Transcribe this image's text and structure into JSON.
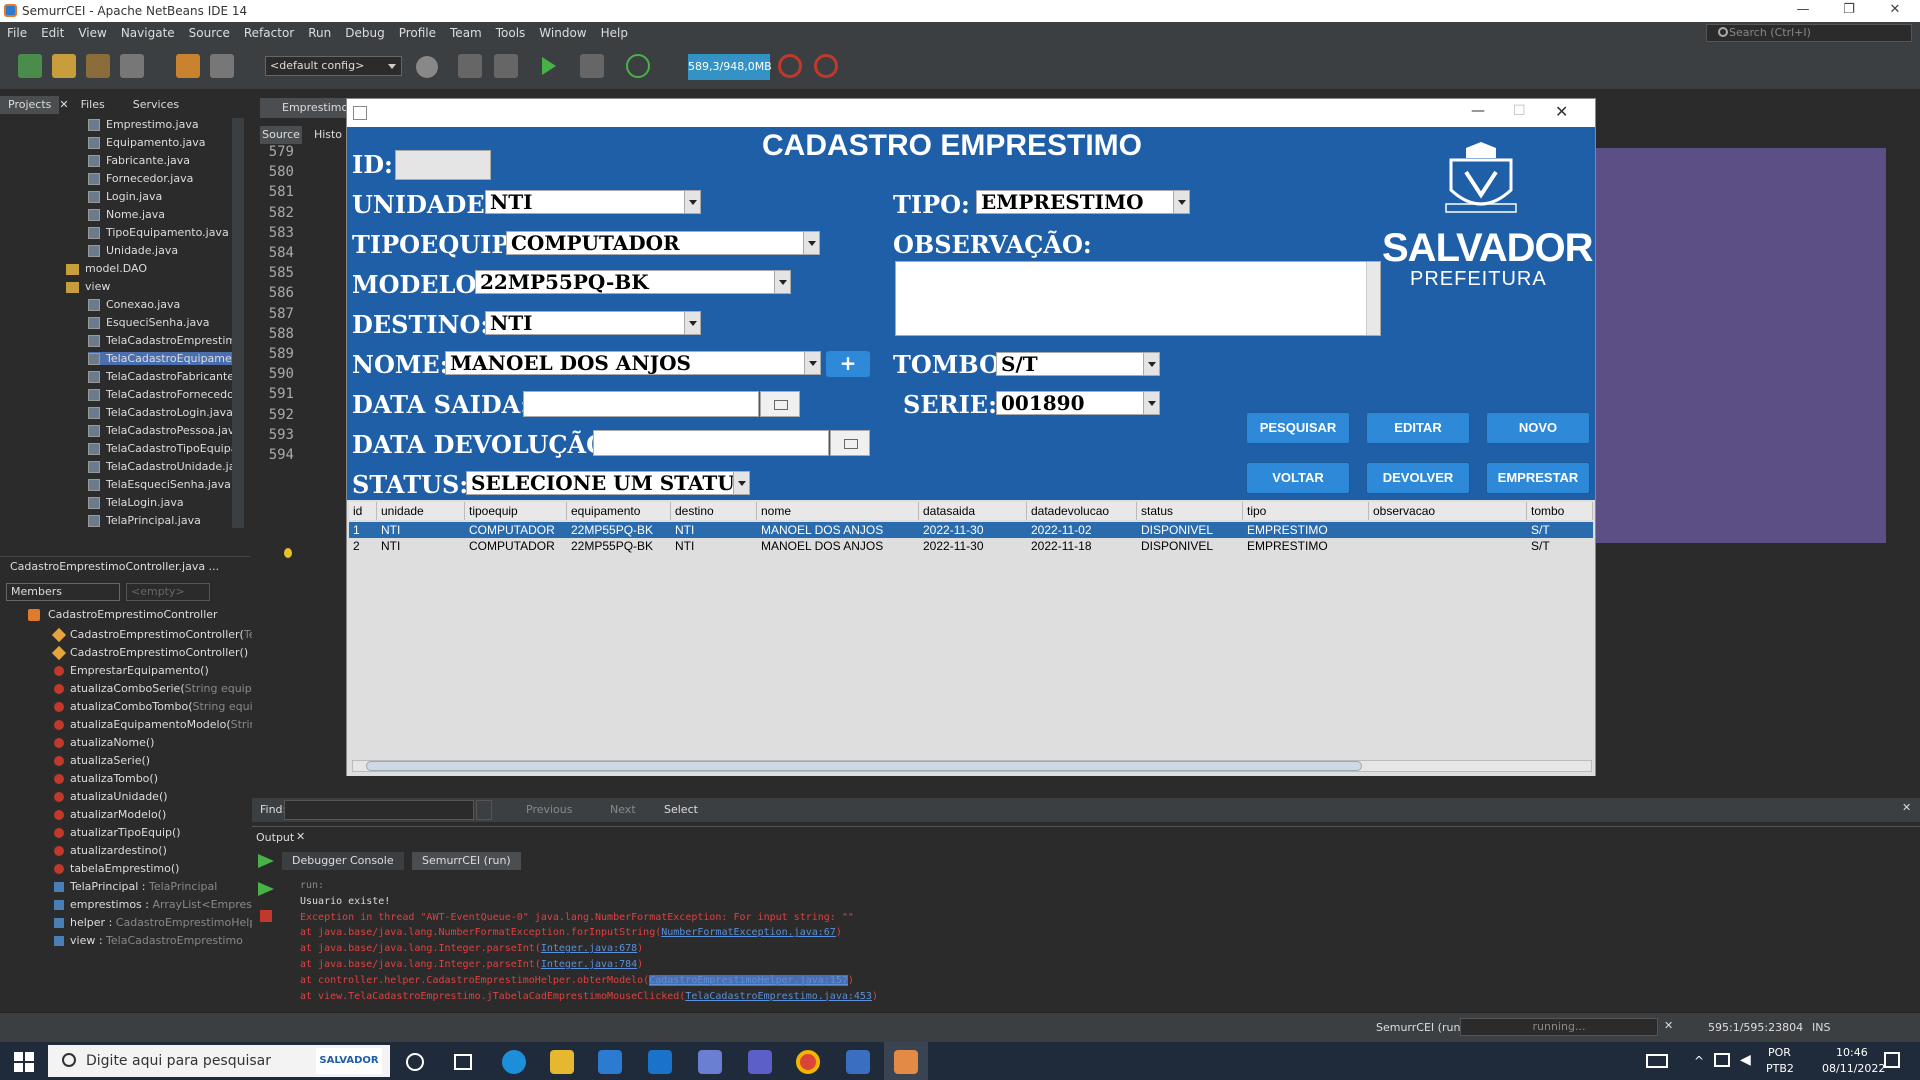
{
  "window": {
    "title": "SemurrCEI - Apache NetBeans IDE 14",
    "search_placeholder": "Search (Ctrl+I)"
  },
  "menu": [
    "File",
    "Edit",
    "View",
    "Navigate",
    "Source",
    "Refactor",
    "Run",
    "Debug",
    "Profile",
    "Team",
    "Tools",
    "Window",
    "Help"
  ],
  "toolbar": {
    "config": "<default config>",
    "memory": "589,3/948,0MB"
  },
  "projects_panel": {
    "tabs": [
      "Projects",
      "Files",
      "Services"
    ],
    "files": [
      "Emprestimo.java",
      "Equipamento.java",
      "Fabricante.java",
      "Fornecedor.java",
      "Login.java",
      "Nome.java",
      "TipoEquipamento.java",
      "Unidade.java"
    ],
    "package_dao": "model.DAO",
    "package_view": "view",
    "view_files": [
      "Conexao.java",
      "EsqueciSenha.java",
      "TelaCadastroEmprestimo",
      "TelaCadastroEquipament",
      "TelaCadastroFabricante.",
      "TelaCadastroFornecedor",
      "TelaCadastroLogin.java",
      "TelaCadastroPessoa.java",
      "TelaCadastroTipoEquipar",
      "TelaCadastroUnidade.jav",
      "TelaEsqueciSenha.java",
      "TelaLogin.java",
      "TelaPrincipal.java"
    ]
  },
  "navigator": {
    "title": "CadastroEmprestimoController.java ...",
    "filter": "Members",
    "filter2": "<empty>",
    "root": "CadastroEmprestimoController",
    "members": [
      {
        "name": "CadastroEmprestimoController(",
        "extra": "TelaC",
        "kind": "ctor"
      },
      {
        "name": "CadastroEmprestimoController()",
        "extra": "",
        "kind": "ctor"
      },
      {
        "name": "EmprestarEquipamento()",
        "extra": "",
        "kind": "method"
      },
      {
        "name": "atualizaComboSerie(",
        "extra": "String equip)",
        "kind": "method"
      },
      {
        "name": "atualizaComboTombo(",
        "extra": "String equip)",
        "kind": "method"
      },
      {
        "name": "atualizaEquipamentoModelo(",
        "extra": "String tip",
        "kind": "method"
      },
      {
        "name": "atualizaNome()",
        "extra": "",
        "kind": "method"
      },
      {
        "name": "atualizaSerie()",
        "extra": "",
        "kind": "method"
      },
      {
        "name": "atualizaTombo()",
        "extra": "",
        "kind": "method"
      },
      {
        "name": "atualizaUnidade()",
        "extra": "",
        "kind": "method"
      },
      {
        "name": "atualizarModelo()",
        "extra": "",
        "kind": "method"
      },
      {
        "name": "atualizarTipoEquip()",
        "extra": "",
        "kind": "method"
      },
      {
        "name": "atualizardestino()",
        "extra": "",
        "kind": "method"
      },
      {
        "name": "tabelaEmprestimo()",
        "extra": "",
        "kind": "method"
      },
      {
        "name": "TelaPrincipal : ",
        "extra": "TelaPrincipal",
        "kind": "field"
      },
      {
        "name": "emprestimos : ",
        "extra": "ArrayList<Emprestimo",
        "kind": "field"
      },
      {
        "name": "helper : ",
        "extra": "CadastroEmprestimoHelper",
        "kind": "field"
      },
      {
        "name": "view : ",
        "extra": "TelaCadastroEmprestimo",
        "kind": "field"
      }
    ]
  },
  "editor": {
    "tab": "Emprestimo.j",
    "subtabs": [
      "Source",
      "Histo"
    ],
    "line_numbers": [
      "579",
      "580",
      "581",
      "582",
      "583",
      "584",
      "585",
      "586",
      "587",
      "588",
      "589",
      "590",
      "591",
      "592",
      "593",
      "594"
    ]
  },
  "dialog": {
    "title": "CADASTRO EMPRESTIMO",
    "labels": {
      "id": "ID:",
      "unidade": "UNIDADE:",
      "tipoequip": "TIPOEQUIP:",
      "modelo": "MODELO:",
      "destino": "DESTINO:",
      "nome": "NOME:",
      "data_saida": "DATA SAIDA:",
      "data_devolucao": "DATA DEVOLUÇÃO:",
      "status": "STATUS:",
      "tipo": "TIPO:",
      "observacao": "OBSERVAÇÃO:",
      "tombo": "TOMBO:",
      "serie": "SERIE:"
    },
    "values": {
      "unidade": "NTI",
      "tipoequip": "COMPUTADOR",
      "modelo": "22MP55PQ-BK",
      "destino": "NTI",
      "nome": "MANOEL DOS ANJOS",
      "status": "SELECIONE UM STATUS",
      "tipo": "EMPRESTIMO",
      "tombo": "S/T",
      "serie": "001890"
    },
    "add_button": "+",
    "logo": {
      "name": "SALVADOR",
      "sub": "PREFEITURA"
    },
    "buttons": {
      "pesquisar": "PESQUISAR",
      "editar": "EDITAR",
      "novo": "NOVO",
      "voltar": "VOLTAR",
      "devolver": "DEVOLVER",
      "emprestar": "EMPRESTAR"
    },
    "table": {
      "columns": [
        "id",
        "unidade",
        "tipoequip",
        "equipamento",
        "destino",
        "nome",
        "datasaida",
        "datadevolucao",
        "status",
        "tipo",
        "observacao",
        "tombo"
      ],
      "rows": [
        [
          "1",
          "NTI",
          "COMPUTADOR",
          "22MP55PQ-BK",
          "NTI",
          "MANOEL DOS ANJOS",
          "2022-11-30",
          "2022-11-02",
          "DISPONIVEL",
          "EMPRESTIMO",
          "",
          "S/T"
        ],
        [
          "2",
          "NTI",
          "COMPUTADOR",
          "22MP55PQ-BK",
          "NTI",
          "MANOEL DOS ANJOS",
          "2022-11-30",
          "2022-11-18",
          "DISPONIVEL",
          "EMPRESTIMO",
          "",
          "S/T"
        ]
      ]
    }
  },
  "findbar": {
    "label": "Find:",
    "previous": "Previous",
    "next": "Next",
    "select": "Select"
  },
  "output": {
    "title": "Output",
    "tabs": [
      "Debugger Console",
      "SemurrCEI (run)"
    ],
    "lines": [
      {
        "text": "run:",
        "link": "",
        "rest": "",
        "color": "#888888"
      },
      {
        "text": "Usuario existe!",
        "link": "",
        "rest": "",
        "color": "#dddddd"
      },
      {
        "text": "Exception in thread \"AWT-EventQueue-0\" java.lang.NumberFormatException: For input string: \"\"",
        "link": "",
        "rest": "",
        "color": "#e04040"
      },
      {
        "text": "        at java.base/java.lang.NumberFormatException.forInputString(",
        "link": "NumberFormatException.java:67",
        "rest": ")",
        "color": "#e04040"
      },
      {
        "text": "        at java.base/java.lang.Integer.parseInt(",
        "link": "Integer.java:678",
        "rest": ")",
        "color": "#e04040"
      },
      {
        "text": "        at java.base/java.lang.Integer.parseInt(",
        "link": "Integer.java:784",
        "rest": ")",
        "color": "#e04040"
      },
      {
        "text": "        at controller.helper.CadastroEmprestimoHelper.obterModelo(",
        "link": "CadastroEmprestimoHelper.java:157",
        "rest": ")",
        "color": "#e04040"
      },
      {
        "text": "        at view.TelaCadastroEmprestimo.jTabelaCadEmprestimoMouseClicked(",
        "link": "TelaCadastroEmprestimo.java:453",
        "rest": ")",
        "color": "#e04040"
      }
    ]
  },
  "statusbar": {
    "run": "SemurrCEI (run)",
    "progress": "running...",
    "position": "595:1/595:23804",
    "mode": "INS"
  },
  "taskbar": {
    "search": "Digite aqui para pesquisar",
    "badge": "SALVADOR",
    "lang1": "POR",
    "lang2": "PTB2",
    "time": "10:46",
    "date": "08/11/2022"
  },
  "colors": {
    "dialog_blue": "#1f5fa8",
    "button_blue": "#2e8ad8",
    "selected_row": "#2a6bad",
    "ide_bg": "#2b2b2b"
  }
}
